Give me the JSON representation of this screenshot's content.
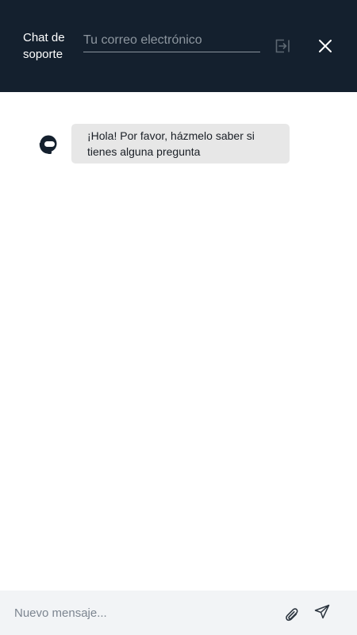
{
  "header": {
    "title": "Chat de soporte",
    "email_placeholder": "Tu correo electrónico",
    "email_value": "",
    "submit_icon": "submit-arrow-icon",
    "close_icon": "close-icon"
  },
  "messages": [
    {
      "sender": "agent",
      "avatar_icon": "support-agent-icon",
      "text": "¡Hola! Por favor, házmelo saber si tienes alguna pregunta"
    }
  ],
  "composer": {
    "placeholder": "Nuevo mensaje...",
    "value": "",
    "attach_icon": "paperclip-icon",
    "send_icon": "send-icon"
  },
  "colors": {
    "header_bg": "#14202e",
    "bubble_bg": "#e7e7e7",
    "composer_bg": "#f2f4f6"
  }
}
